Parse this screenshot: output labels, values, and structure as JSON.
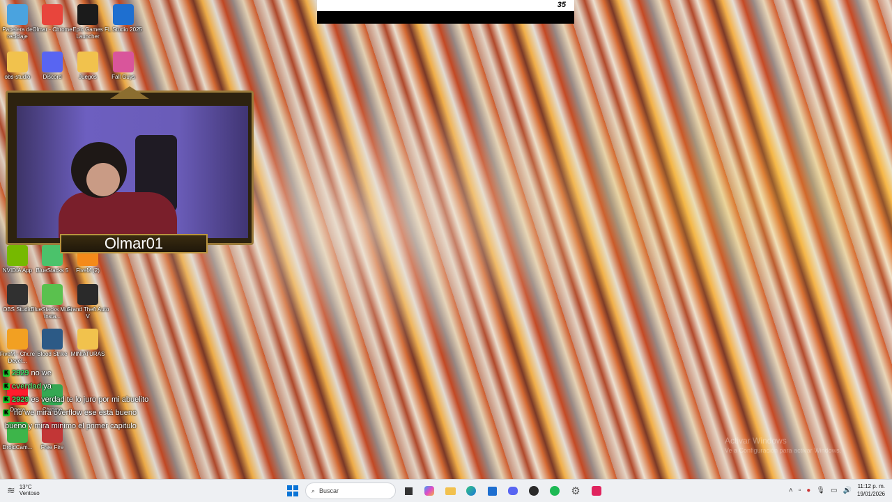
{
  "desktop_icons": [
    {
      "label": "Papelera de reciclaje",
      "icon": "recycle-bin-icon",
      "color": "#4aa3df"
    },
    {
      "label": "Olmar - Chrome",
      "icon": "chrome-icon",
      "color": "#e8453c"
    },
    {
      "label": "Epic Games Launcher",
      "icon": "epic-games-icon",
      "color": "#1b1b1b"
    },
    {
      "label": "FL Studio 2025",
      "icon": "fl-studio-icon",
      "color": "#1e6fd0"
    },
    {
      "label": "obs-studio",
      "icon": "folder-icon",
      "color": "#f1c24d"
    },
    {
      "label": "Discord",
      "icon": "discord-icon",
      "color": "#5865f2"
    },
    {
      "label": "Juegos",
      "icon": "folder-icon",
      "color": "#f1c24d"
    },
    {
      "label": "Fall Guys",
      "icon": "fall-guys-icon",
      "color": "#d9559b"
    },
    {
      "label": "NVIDIA App",
      "icon": "nvidia-icon",
      "color": "#76b900"
    },
    {
      "label": "BlueStacks 5",
      "icon": "bluestacks-icon",
      "color": "#4bc26b"
    },
    {
      "label": "FiveM (2)",
      "icon": "fivem-icon",
      "color": "#f48a1a"
    },
    {
      "label": "OBS Studio",
      "icon": "obs-icon",
      "color": "#303030"
    },
    {
      "label": "BlueStacks Multi-Insta...",
      "icon": "bluestacks-multi-icon",
      "color": "#5ac14e"
    },
    {
      "label": "Grand Theft Auto V",
      "icon": "gta-icon",
      "color": "#2a2a2a"
    },
    {
      "label": "FiveM - Cfx.re Devel...",
      "icon": "fivem-dev-icon",
      "color": "#f2a022"
    },
    {
      "label": "Blood Strike",
      "icon": "blood-strike-icon",
      "color": "#2c5a86"
    },
    {
      "label": "MINIATURAS",
      "icon": "folder-icon",
      "color": "#f1c24d"
    },
    {
      "label": "Opera",
      "icon": "opera-icon",
      "color": "#ff1b2d"
    },
    {
      "label": "Chrome",
      "icon": "chrome-icon",
      "color": "#34a853"
    },
    {
      "label": "DroidCam...",
      "icon": "droidcam-icon",
      "color": "#3db54a"
    },
    {
      "label": "Free Fire",
      "icon": "free-fire-icon",
      "color": "#c23636"
    }
  ],
  "top_overlay": {
    "counter": "35"
  },
  "webcam": {
    "name": "Olmar01"
  },
  "chat": [
    {
      "user": "2929",
      "message": "no we",
      "user_class": "u1"
    },
    {
      "user": "cverdad",
      "message": "ya",
      "user_class": "u2"
    },
    {
      "user": "2929",
      "message": "es verdad te lo juro por mi abuelito",
      "user_class": "u1"
    },
    {
      "user": "",
      "message": "no we mira overflow ese está bueno",
      "user_class": "u4"
    },
    {
      "user": "",
      "message": "bueno y mira minimo el primer capitulo",
      "user_class": "u3"
    }
  ],
  "activate_windows": {
    "title": "Activar Windows",
    "subtitle": "Ve a Configuración para activar Windows."
  },
  "taskbar": {
    "weather_temp": "13°C",
    "weather_desc": "Ventoso",
    "search_placeholder": "Buscar",
    "time": "11:12 p. m.",
    "date": "19/01/2026"
  }
}
